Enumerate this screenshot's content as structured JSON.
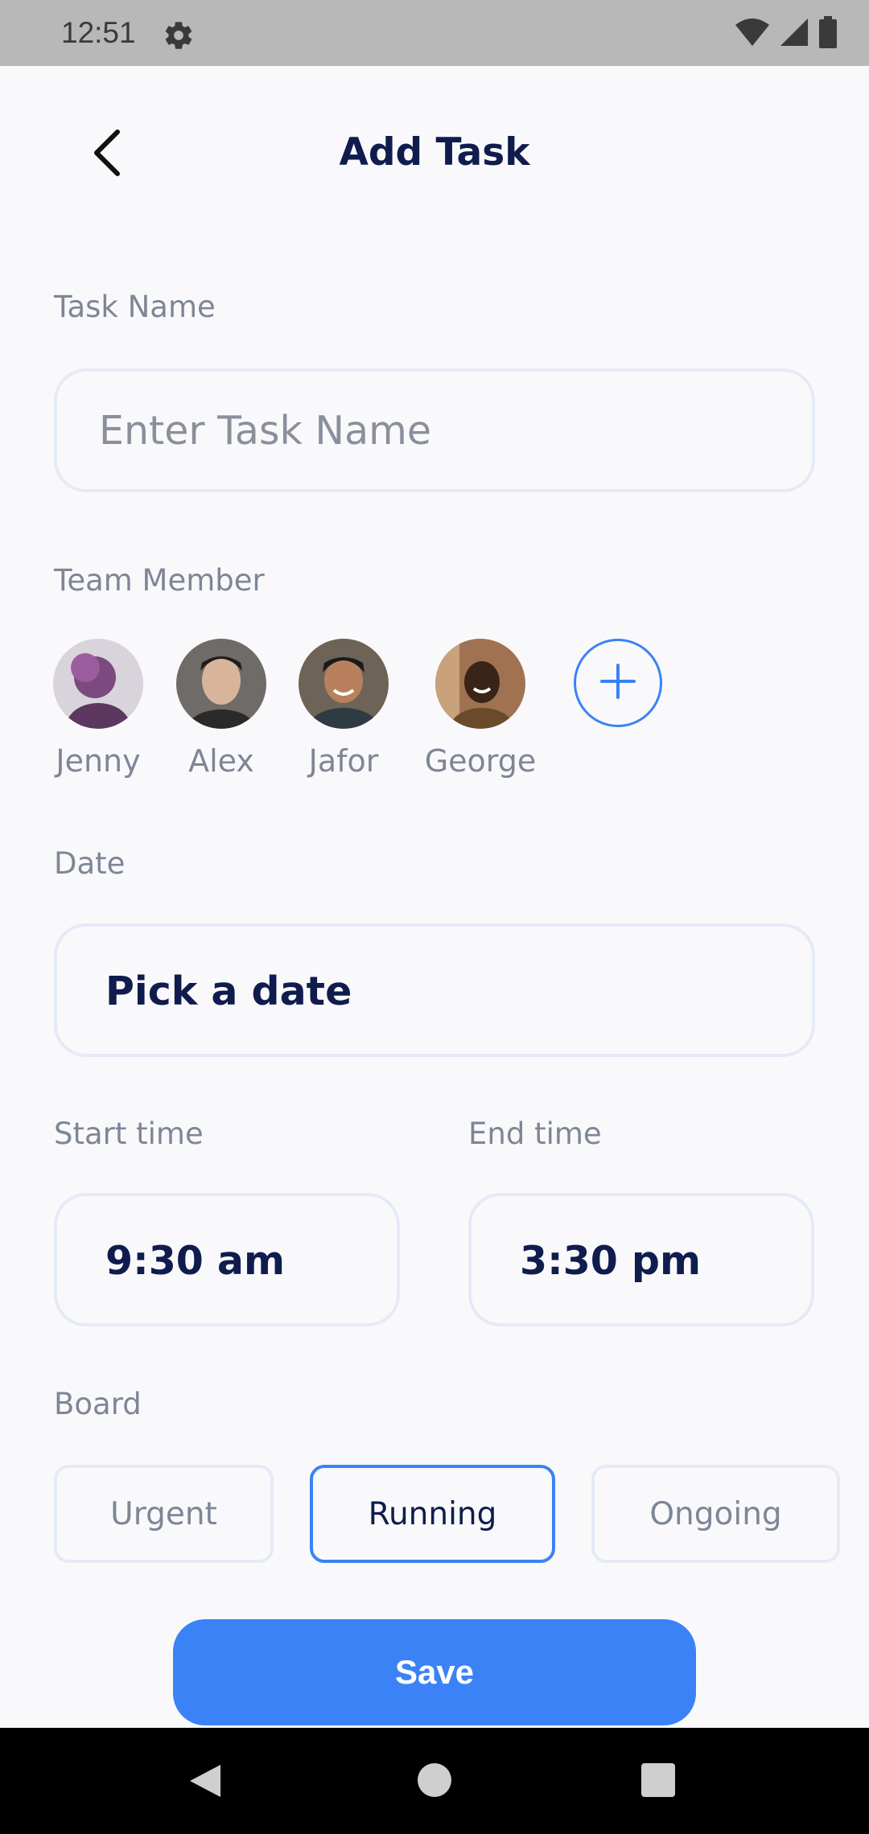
{
  "status_bar": {
    "time": "12:51",
    "icons": [
      "gear-icon",
      "wifi-icon",
      "signal-icon",
      "battery-icon"
    ]
  },
  "header": {
    "title": "Add Task",
    "back_icon": "chevron-left-icon"
  },
  "task_name": {
    "label": "Task Name",
    "placeholder": "Enter Task Name",
    "value": ""
  },
  "team": {
    "label": "Team Member",
    "members": [
      {
        "name": "Jenny",
        "avatar_color": "#7b4a7e"
      },
      {
        "name": "Alex",
        "avatar_color": "#5d5a57"
      },
      {
        "name": "Jafor",
        "avatar_color": "#4a3a30"
      },
      {
        "name": "George",
        "avatar_color": "#8a5a3a"
      }
    ],
    "add_icon": "plus-icon"
  },
  "date": {
    "label": "Date",
    "value": "Pick a date"
  },
  "start_time": {
    "label": "Start time",
    "value": "9:30 am"
  },
  "end_time": {
    "label": "End time",
    "value": "3:30 pm"
  },
  "board": {
    "label": "Board",
    "options": [
      "Urgent",
      "Running",
      "Ongoing"
    ],
    "selected": "Running"
  },
  "save_label": "Save",
  "colors": {
    "accent": "#3b82f6",
    "title": "#0f1c4d",
    "muted": "#7e8696",
    "border": "#e5eaf8"
  }
}
